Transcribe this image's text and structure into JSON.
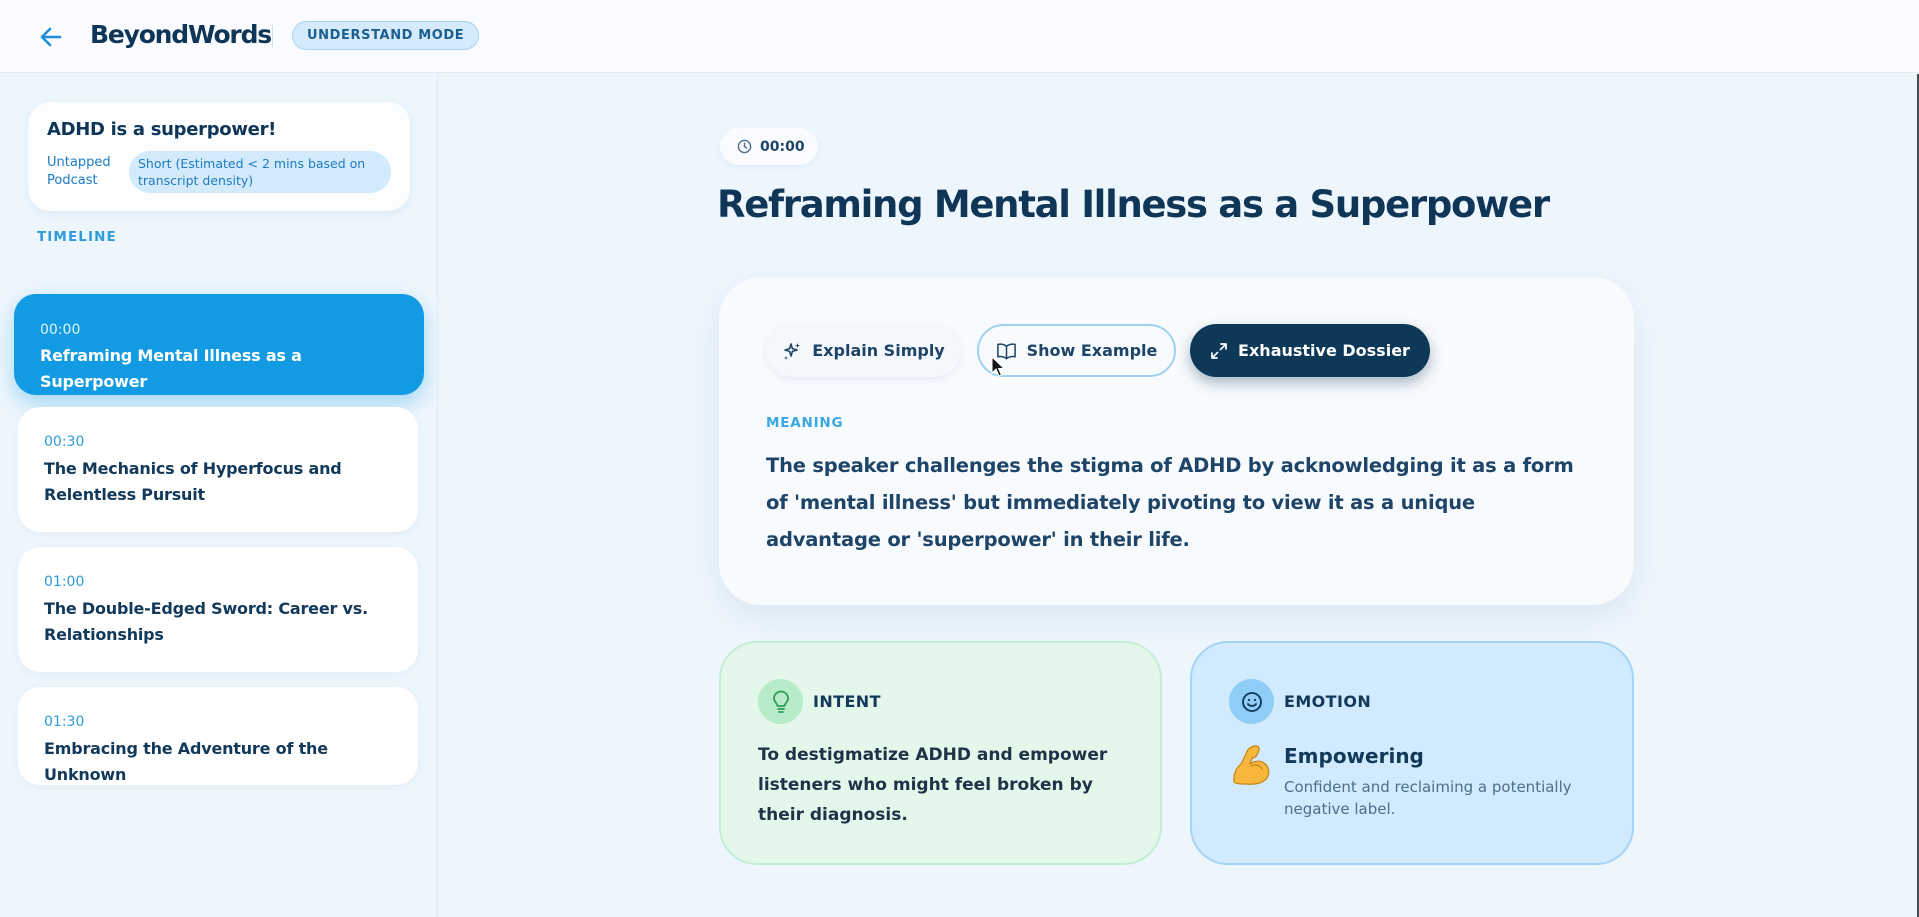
{
  "header": {
    "brand": "BeyondWords",
    "mode_badge": "UNDERSTAND MODE"
  },
  "sidebar": {
    "episode": {
      "title": "ADHD is a superpower!",
      "source": "Untapped Podcast",
      "duration": "Short (Estimated < 2 mins based on transcript density)"
    },
    "timeline_label": "TIMELINE",
    "segments": [
      {
        "time": "00:00",
        "title": "Reframing Mental Illness as a Superpower",
        "active": true
      },
      {
        "time": "00:30",
        "title": "The Mechanics of Hyperfocus and Relentless Pursuit",
        "active": false
      },
      {
        "time": "01:00",
        "title": "The Double-Edged Sword: Career vs. Relationships",
        "active": false
      },
      {
        "time": "01:30",
        "title": "Embracing the Adventure of the Unknown",
        "active": false
      }
    ]
  },
  "main": {
    "timestamp": "00:00",
    "title": "Reframing Mental Illness as a Superpower",
    "actions": {
      "explain": "Explain Simply",
      "example": "Show Example",
      "dossier": "Exhaustive Dossier"
    },
    "meaning_label": "MEANING",
    "meaning_text": "The speaker challenges the stigma of ADHD by acknowledging it as a form of 'mental illness' but immediately pivoting to view it as a unique advantage or 'superpower' in their life.",
    "intent": {
      "label": "INTENT",
      "text": "To destigmatize ADHD and empower listeners who might feel broken by their diagnosis."
    },
    "emotion": {
      "label": "EMOTION",
      "name": "Empowering",
      "description": "Confident and reclaiming a potentially negative label."
    }
  },
  "colors": {
    "accent": "#129be3",
    "navy": "#0d3857",
    "intent_bg": "#e3f7ea",
    "emotion_bg": "#d2eafd"
  },
  "icons": [
    "arrow-left-icon",
    "clock-icon",
    "sparkles-icon",
    "book-open-icon",
    "expand-icon",
    "lightbulb-icon",
    "smile-icon",
    "flexed-biceps-icon"
  ]
}
